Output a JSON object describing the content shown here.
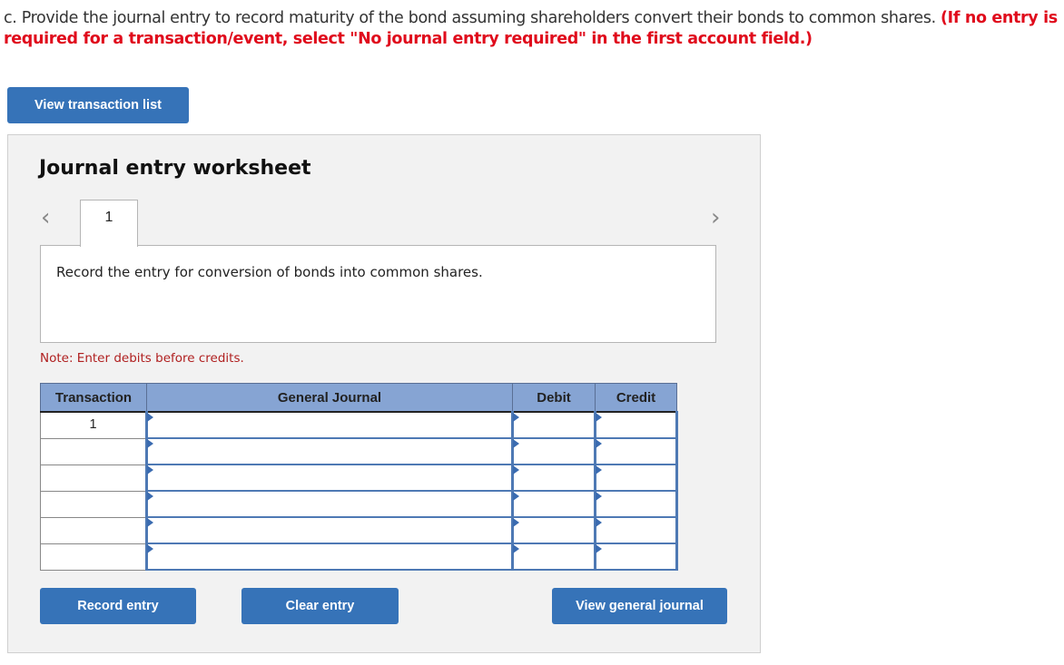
{
  "question": {
    "text": "c. Provide the journal entry to record maturity of the bond assuming shareholders convert their bonds to common shares.",
    "instruction": "(If no entry is required for a transaction/event, select \"No journal entry required\" in the first account field.)"
  },
  "buttons": {
    "view_transaction_list": "View transaction list",
    "record_entry": "Record entry",
    "clear_entry": "Clear entry",
    "view_general_journal": "View general journal"
  },
  "worksheet": {
    "title": "Journal entry worksheet",
    "prev_icon": "chevron-left-icon",
    "next_icon": "chevron-right-icon",
    "tabs": [
      {
        "label": "1"
      }
    ],
    "description": "Record the entry for conversion of bonds into common shares.",
    "note": "Note: Enter debits before credits."
  },
  "table": {
    "headers": {
      "transaction": "Transaction",
      "general_journal": "General Journal",
      "debit": "Debit",
      "credit": "Credit"
    },
    "rows": [
      {
        "transaction": "1",
        "account": "",
        "debit": "",
        "credit": ""
      },
      {
        "transaction": "",
        "account": "",
        "debit": "",
        "credit": ""
      },
      {
        "transaction": "",
        "account": "",
        "debit": "",
        "credit": ""
      },
      {
        "transaction": "",
        "account": "",
        "debit": "",
        "credit": ""
      },
      {
        "transaction": "",
        "account": "",
        "debit": "",
        "credit": ""
      },
      {
        "transaction": "",
        "account": "",
        "debit": "",
        "credit": ""
      }
    ]
  },
  "colors": {
    "button": "#3673b8",
    "header": "#86a4d3",
    "instruction": "#e00b1c",
    "note": "#b02020"
  }
}
